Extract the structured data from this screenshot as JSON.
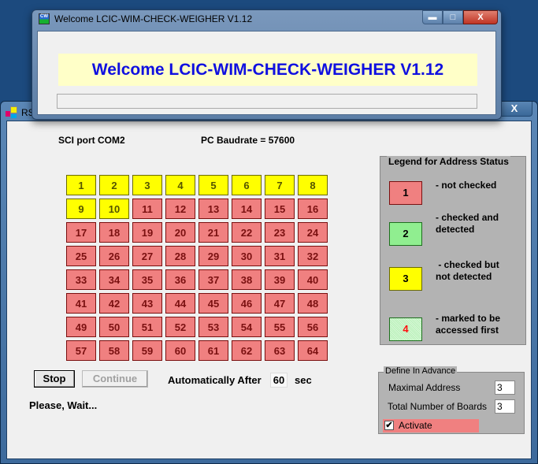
{
  "main_window": {
    "title": "RS",
    "close_label": "X"
  },
  "info": {
    "sci_port": "SCI port COM2",
    "baudrate": "PC Baudrate = 57600"
  },
  "grid": {
    "cells": [
      {
        "n": "1",
        "status": "checked-not-detected"
      },
      {
        "n": "2",
        "status": "checked-not-detected"
      },
      {
        "n": "3",
        "status": "checked-not-detected"
      },
      {
        "n": "4",
        "status": "checked-not-detected"
      },
      {
        "n": "5",
        "status": "checked-not-detected"
      },
      {
        "n": "6",
        "status": "checked-not-detected"
      },
      {
        "n": "7",
        "status": "checked-not-detected"
      },
      {
        "n": "8",
        "status": "checked-not-detected"
      },
      {
        "n": "9",
        "status": "checked-not-detected"
      },
      {
        "n": "10",
        "status": "checked-not-detected"
      },
      {
        "n": "11",
        "status": "not-checked"
      },
      {
        "n": "12",
        "status": "not-checked"
      },
      {
        "n": "13",
        "status": "not-checked"
      },
      {
        "n": "14",
        "status": "not-checked"
      },
      {
        "n": "15",
        "status": "not-checked"
      },
      {
        "n": "16",
        "status": "not-checked"
      },
      {
        "n": "17",
        "status": "not-checked"
      },
      {
        "n": "18",
        "status": "not-checked"
      },
      {
        "n": "19",
        "status": "not-checked"
      },
      {
        "n": "20",
        "status": "not-checked"
      },
      {
        "n": "21",
        "status": "not-checked"
      },
      {
        "n": "22",
        "status": "not-checked"
      },
      {
        "n": "23",
        "status": "not-checked"
      },
      {
        "n": "24",
        "status": "not-checked"
      },
      {
        "n": "25",
        "status": "not-checked"
      },
      {
        "n": "26",
        "status": "not-checked"
      },
      {
        "n": "27",
        "status": "not-checked"
      },
      {
        "n": "28",
        "status": "not-checked"
      },
      {
        "n": "29",
        "status": "not-checked"
      },
      {
        "n": "30",
        "status": "not-checked"
      },
      {
        "n": "31",
        "status": "not-checked"
      },
      {
        "n": "32",
        "status": "not-checked"
      },
      {
        "n": "33",
        "status": "not-checked"
      },
      {
        "n": "34",
        "status": "not-checked"
      },
      {
        "n": "35",
        "status": "not-checked"
      },
      {
        "n": "36",
        "status": "not-checked"
      },
      {
        "n": "37",
        "status": "not-checked"
      },
      {
        "n": "38",
        "status": "not-checked"
      },
      {
        "n": "39",
        "status": "not-checked"
      },
      {
        "n": "40",
        "status": "not-checked"
      },
      {
        "n": "41",
        "status": "not-checked"
      },
      {
        "n": "42",
        "status": "not-checked"
      },
      {
        "n": "43",
        "status": "not-checked"
      },
      {
        "n": "44",
        "status": "not-checked"
      },
      {
        "n": "45",
        "status": "not-checked"
      },
      {
        "n": "46",
        "status": "not-checked"
      },
      {
        "n": "47",
        "status": "not-checked"
      },
      {
        "n": "48",
        "status": "not-checked"
      },
      {
        "n": "49",
        "status": "not-checked"
      },
      {
        "n": "50",
        "status": "not-checked"
      },
      {
        "n": "51",
        "status": "not-checked"
      },
      {
        "n": "52",
        "status": "not-checked"
      },
      {
        "n": "53",
        "status": "not-checked"
      },
      {
        "n": "54",
        "status": "not-checked"
      },
      {
        "n": "55",
        "status": "not-checked"
      },
      {
        "n": "56",
        "status": "not-checked"
      },
      {
        "n": "57",
        "status": "not-checked"
      },
      {
        "n": "58",
        "status": "not-checked"
      },
      {
        "n": "59",
        "status": "not-checked"
      },
      {
        "n": "60",
        "status": "not-checked"
      },
      {
        "n": "61",
        "status": "not-checked"
      },
      {
        "n": "62",
        "status": "not-checked"
      },
      {
        "n": "63",
        "status": "not-checked"
      },
      {
        "n": "64",
        "status": "not-checked"
      }
    ]
  },
  "controls": {
    "stop_label": "Stop",
    "continue_label": "Continue",
    "auto_label": "Automatically After",
    "auto_value": "60",
    "auto_unit": "sec",
    "status_text": "Please, Wait..."
  },
  "legend": {
    "title": "Legend for Address Status",
    "items": [
      {
        "num": "1",
        "text_line1": "- not checked",
        "text_line2": ""
      },
      {
        "num": "2",
        "text_line1": "- checked and",
        "text_line2": "detected"
      },
      {
        "num": "3",
        "text_line1": " - checked but",
        "text_line2": "not detected"
      },
      {
        "num": "4",
        "text_line1": "- marked to be",
        "text_line2": "accessed first"
      }
    ]
  },
  "define": {
    "title": "Define In Advance",
    "max_address_label": "Maximal Address",
    "max_address_value": "3",
    "boards_label": "Total Number of Boards",
    "boards_value": "3",
    "activate_label": "Activate",
    "activate_checked": true,
    "check_glyph": "✔"
  },
  "welcome": {
    "title": "Welcome LCIC-WIM-CHECK-WEIGHER V1.12",
    "icon_text": "CW",
    "banner": "Welcome LCIC-WIM-CHECK-WEIGHER V1.12",
    "progress": 0,
    "min_glyph": "▬",
    "max_glyph": "□",
    "close_glyph": "X"
  },
  "colors": {
    "not_checked": "#f08080",
    "checked_detected": "#90ee90",
    "checked_not_detected": "#ffff00",
    "banner_text": "#1010e0",
    "banner_bg": "#ffffc8"
  }
}
